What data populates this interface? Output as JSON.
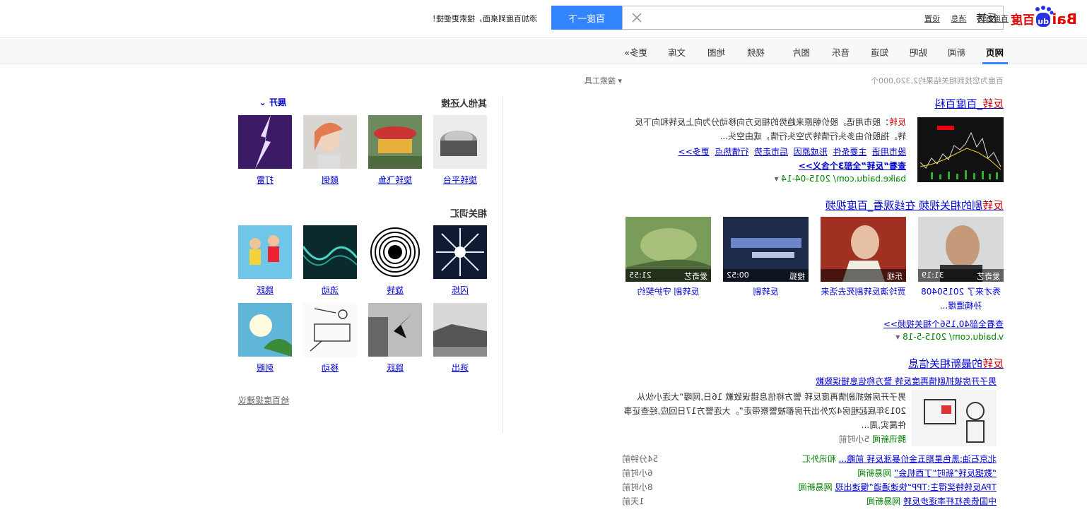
{
  "header": {
    "logo_text": "Bai",
    "logo_text2": "百度",
    "logo_du": "du",
    "search_value": "反转",
    "search_button": "百度一下",
    "promo": "添加百度到桌面，搜索更便捷！",
    "top_links": [
      "百度首页",
      "消息",
      "设置"
    ]
  },
  "nav": {
    "tabs": [
      "网页",
      "新闻",
      "贴吧",
      "知道",
      "音乐",
      "图片",
      "视频",
      "地图",
      "文库",
      "更多»"
    ]
  },
  "results": {
    "count": "百度为您找到相关结果约2,320,000个",
    "tools": "搜索工具",
    "r1": {
      "title_red": "反转",
      "title_rest": "_百度百科",
      "abs1_red": "反转",
      "abs1": "：股市用语。股价朝原来趋势的相反方向移动分为向上反转和向下反转。指股价由多头行情转为空头行情，或由空头...",
      "links": [
        "股市用语",
        "主要条件",
        "形成原因",
        "后市走势",
        "行情热点",
        "更多>>"
      ],
      "view_all": "查看“反转”全部3个含义>>",
      "url": "baike.baidu.com/ 2015-04-14"
    },
    "r2": {
      "title_red": "反转",
      "title_rest": "剧的相关视频 在线观看_百度视频",
      "videos": [
        {
          "src": "爱奇艺",
          "dur": "31:19",
          "cap": "秀才来了 20150408 孙楠遭爆..."
        },
        {
          "src": "乐视",
          "dur": "",
          "cap": "贾玲演反转剧死去活来"
        },
        {
          "src": "搜狐",
          "dur": "00:52",
          "cap": "反转剧"
        },
        {
          "src": "爱奇艺",
          "dur": "21:55",
          "cap": "反转剧 守护契约"
        }
      ],
      "view_all": "查看全部40,156个相关视频>>",
      "url": "v.baidu.com/ 2015-5-18"
    },
    "r3": {
      "title_red": "反转",
      "title_rest": "的最新相关信息",
      "headline": "男子开房被抓剧情再度反转 警方称信息错误致歉",
      "abs": "男子开房被抓剧情再度反转 警方称信息错误致歉 16日,网曝“大连小伙从2013年底起租房4次外出开房都被警察带走”。大连警方17日回应,经查证事件属实,周...",
      "source": "腾讯新闻",
      "time": "5小时前",
      "news": [
        {
          "t": "北京石油:黑色星期五金价暴涨反转 前瞻...",
          "s": "和讯外汇",
          "time": "54分钟前"
        },
        {
          "t": "“数据反转”新时“丁西机会”",
          "s": "网易新闻",
          "time": "6小时前"
        },
        {
          "t": "TPA反转特奖得主:TPP“快速通道”慢速出现",
          "s": "网易新闻",
          "time": "8小时前"
        },
        {
          "t": "中国债务杠杆率逐步反转",
          "s": "网易新闻",
          "time": "1天前"
        }
      ]
    }
  },
  "right": {
    "others_title": "其他人还搜",
    "expand": "展开",
    "others": [
      "旋转平台",
      "旋转飞鱼",
      "颠倒",
      "打雷"
    ],
    "related_title": "相关词汇",
    "related": [
      "闪烁",
      "旋转",
      "流动",
      "跳跃",
      "逃出",
      "跳跃",
      "移动",
      "刺眼"
    ],
    "feedback": "给百度提建议"
  },
  "colors": {
    "accent": "#3385ff",
    "link": "#0000cc",
    "highlight": "#cc0000",
    "url": "#008000"
  }
}
